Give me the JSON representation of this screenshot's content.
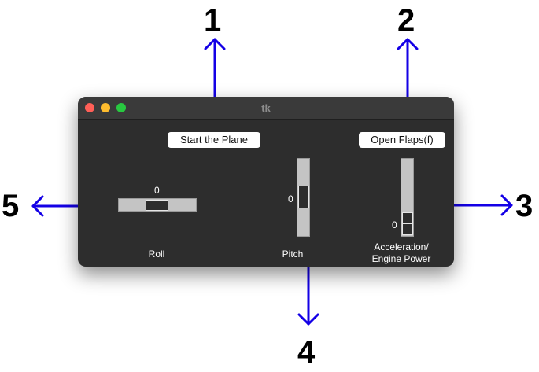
{
  "window": {
    "title": "tk",
    "start_button_label": "Start the Plane",
    "flaps_button_label": "Open Flaps(f)",
    "roll": {
      "value": "0",
      "label": "Roll"
    },
    "pitch": {
      "value": "0",
      "label": "Pitch"
    },
    "acceleration": {
      "value": "0",
      "label_line1": "Acceleration/",
      "label_line2": "Engine Power"
    }
  },
  "callouts": [
    "1",
    "2",
    "3",
    "4",
    "5"
  ],
  "colors": {
    "arrow": "#1400e6",
    "window_bg": "#2d2d2d",
    "slider_trough": "#c4c4c4"
  }
}
